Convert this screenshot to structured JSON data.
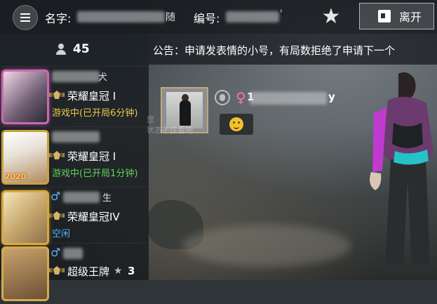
{
  "header": {
    "name_label": "名字:",
    "name_tail": "随",
    "id_label": "编号:",
    "id_tail": "'",
    "leave_label": "离开"
  },
  "sidebar": {
    "online_count": "45",
    "friends": [
      {
        "name_tail": "犬",
        "rank": "荣耀皇冠 I",
        "status": "游戏中(已开局6分钟)"
      },
      {
        "name_tail": "",
        "rank": "荣耀皇冠 I",
        "status": "游戏中(已开局1分钟)",
        "frame_badge": "2020"
      },
      {
        "gender": "♂",
        "name_tail": "生",
        "rank": "荣耀皇冠IV",
        "status": "空闲"
      },
      {
        "gender": "♂",
        "name_tail": "",
        "rank": "超级王牌",
        "stars": "3"
      }
    ]
  },
  "notice": {
    "text": "公告：申请发表情的小号，有局数拒绝了申请下一个"
  },
  "chat": {
    "gender": "♀",
    "name_start": "1",
    "name_end": "y",
    "ghost_lines": [
      "您",
      "状态不佳看吧"
    ]
  },
  "icons": {
    "menu": "menu-icon",
    "favorite": "star-icon",
    "leave": "exit-icon",
    "online": "person-icon",
    "voice": "voice-icon",
    "emoji": "thinking-emoji"
  }
}
